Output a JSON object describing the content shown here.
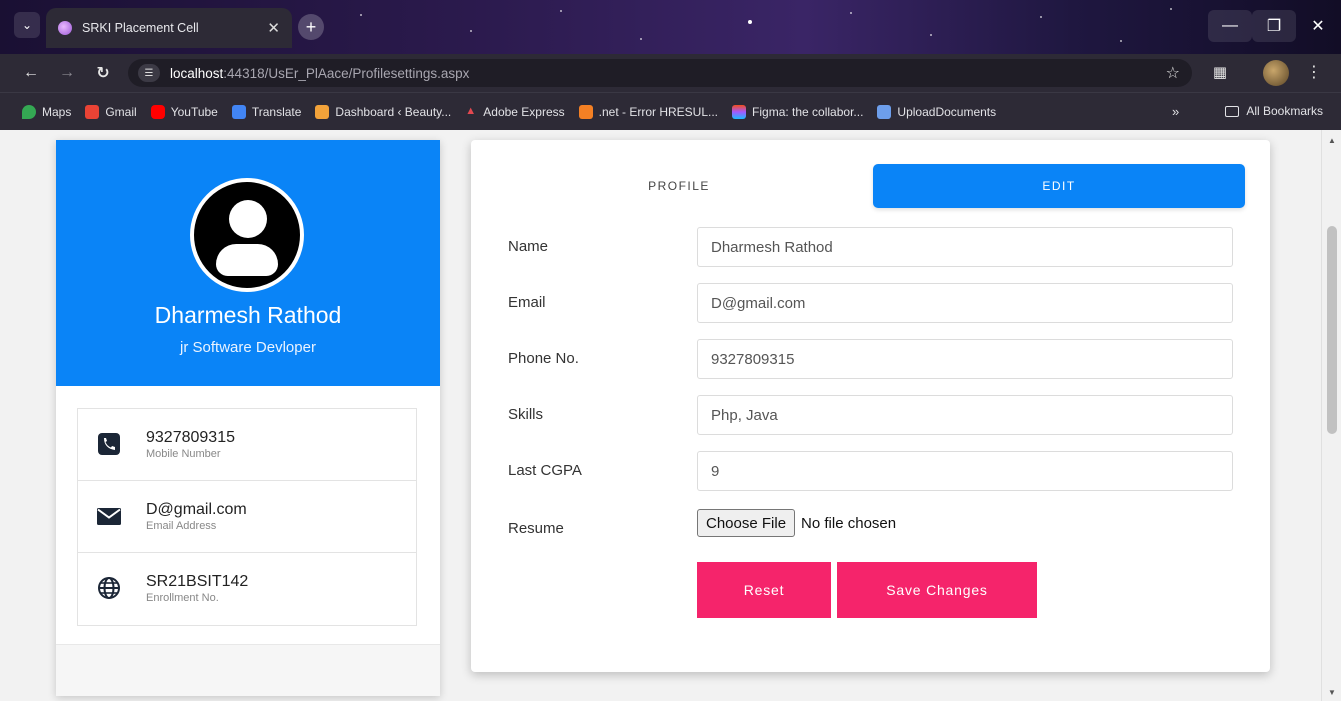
{
  "browser": {
    "tab_title": "SRKI Placement Cell",
    "url_host": "localhost",
    "url_rest": ":44318/UsEr_PlAace/Profilesettings.aspx",
    "bookmarks": [
      {
        "label": "Maps",
        "color": "#34a853"
      },
      {
        "label": "Gmail",
        "color": "#ea4335"
      },
      {
        "label": "YouTube",
        "color": "#ff0000"
      },
      {
        "label": "Translate",
        "color": "#4285f4"
      },
      {
        "label": "Dashboard ‹ Beauty...",
        "color": "#f2a23a"
      },
      {
        "label": "Adobe Express",
        "color": "#e34850"
      },
      {
        "label": ".net - Error HRESUL...",
        "color": "#f48024"
      },
      {
        "label": "Figma: the collabor...",
        "color": "#a259ff"
      },
      {
        "label": "UploadDocuments",
        "color": "#6d9eeb"
      }
    ],
    "bookmarks_more": "»",
    "all_bookmarks": "All Bookmarks"
  },
  "profile": {
    "name": "Dharmesh Rathod",
    "role": "jr Software Devloper",
    "info": [
      {
        "icon": "phone-icon",
        "value": "9327809315",
        "label": "Mobile Number"
      },
      {
        "icon": "envelope-icon",
        "value": "D@gmail.com",
        "label": "Email Address"
      },
      {
        "icon": "globe-icon",
        "value": "SR21BSIT142",
        "label": "Enrollment No."
      }
    ]
  },
  "edit": {
    "tab_profile": "PROFILE",
    "tab_edit": "EDIT",
    "fields": {
      "name": {
        "label": "Name",
        "value": "Dharmesh Rathod"
      },
      "email": {
        "label": "Email",
        "value": "D@gmail.com"
      },
      "phone": {
        "label": "Phone No.",
        "value": "9327809315"
      },
      "skills": {
        "label": "Skills",
        "value": "Php, Java"
      },
      "cgpa": {
        "label": "Last CGPA",
        "value": "9"
      },
      "resume": {
        "label": "Resume",
        "button": "Choose File",
        "status": "No file chosen"
      }
    },
    "reset_label": "Reset",
    "save_label": "Save Changes"
  },
  "colors": {
    "primary": "#0a84f7",
    "accent": "#f5246b"
  }
}
